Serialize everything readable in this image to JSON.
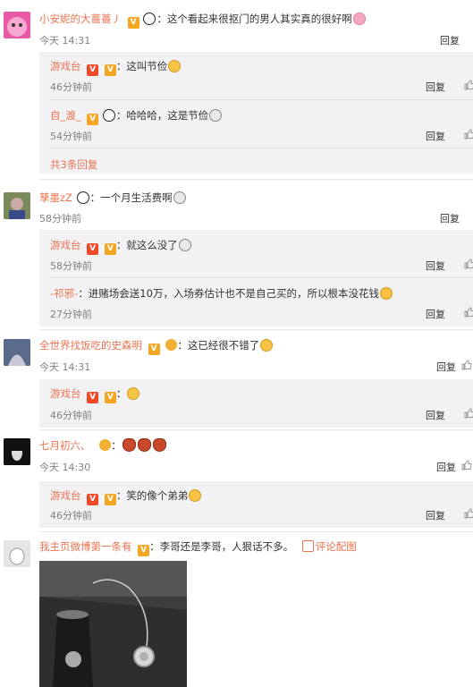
{
  "comments": [
    {
      "user": "小安妮的大薔薔丿",
      "text": "这个看起来很抠门的男人其实真的很好啊",
      "time": "今天 14:31",
      "reply_label": "回复",
      "replies": [
        {
          "user": "游戏台",
          "text": "这叫节俭",
          "time": "46分钟前",
          "reply_label": "回复"
        },
        {
          "user": "自_渡_",
          "text": "哈哈哈，这是节俭",
          "time": "54分钟前",
          "reply_label": "回复"
        }
      ],
      "more_label": "共3条回复"
    },
    {
      "user": "孳墨zZ",
      "text": "一个月生活费啊",
      "time": "58分钟前",
      "reply_label": "回复",
      "replies": [
        {
          "user": "游戏台",
          "text": "就这么没了",
          "time": "58分钟前",
          "reply_label": "回复"
        },
        {
          "user": "-祁邪-",
          "text": "进赌场会送10万，入场券估计也不是自己买的，所以根本没花钱",
          "time": "27分钟前",
          "reply_label": "回复"
        }
      ]
    },
    {
      "user": "全世界找饭吃的史森明",
      "text": "这已经很不错了",
      "time": "今天 14:31",
      "reply_label": "回复",
      "replies": [
        {
          "user": "游戏台",
          "text": "",
          "time": "46分钟前",
          "reply_label": "回复"
        }
      ]
    },
    {
      "user": "七月初六、",
      "text": "",
      "time": "今天 14:30",
      "reply_label": "回复",
      "replies": [
        {
          "user": "游戏台",
          "text": "笑的像个弟弟",
          "time": "46分钟前",
          "reply_label": "回复"
        }
      ]
    },
    {
      "user": "我主页微博第一条有",
      "text": "李哥还是李哥，人狠话不多。",
      "link": "评论配图"
    }
  ]
}
